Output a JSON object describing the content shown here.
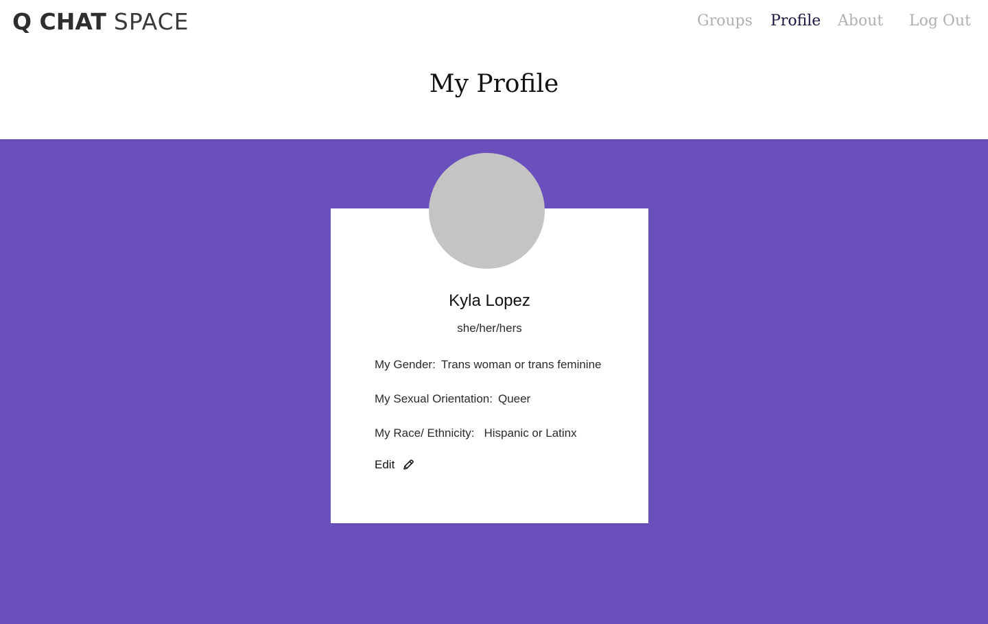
{
  "header": {
    "logo_bold": "Q CHAT",
    "logo_light": "SPACE",
    "nav": [
      {
        "label": "Groups",
        "active": false
      },
      {
        "label": "Profile",
        "active": true
      },
      {
        "label": "About",
        "active": false
      },
      {
        "label": "Log Out",
        "active": false
      }
    ]
  },
  "page": {
    "title": "My Profile"
  },
  "profile": {
    "name": "Kyla Lopez",
    "pronouns": "she/her/hers",
    "fields": {
      "gender": {
        "label": "My Gender:",
        "value": "Trans woman or trans feminine"
      },
      "orientation": {
        "label": "My Sexual Orientation:",
        "value": "Queer"
      },
      "race": {
        "label": "My Race/ Ethnicity:",
        "value": "Hispanic or Latinx"
      }
    },
    "edit_label": "Edit",
    "edit_icon": "pencil-icon"
  },
  "colors": {
    "band": "#6a50bd",
    "avatar_placeholder": "#c4c4c4",
    "nav_active": "#1c1340",
    "nav_inactive": "#b0b0b0"
  }
}
